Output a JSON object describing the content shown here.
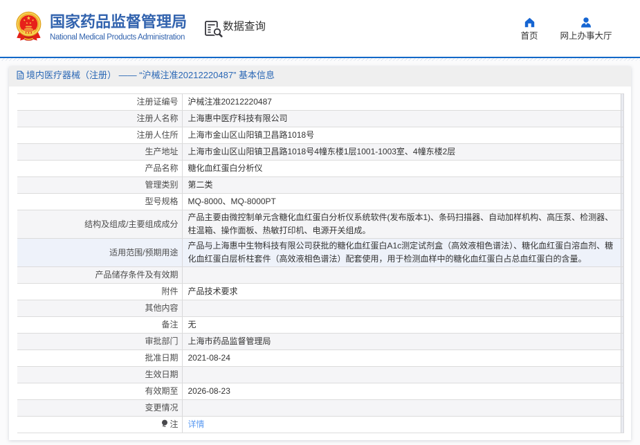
{
  "brand": {
    "title_cn": "国家药品监督管理局",
    "title_en": "National Medical Products Administration",
    "emblem_icon": "china-national-emblem"
  },
  "nav": {
    "data_query": {
      "label": "数据查询",
      "icon": "document-search-icon"
    },
    "home": {
      "label": "首页",
      "icon": "home-icon"
    },
    "hall": {
      "label": "网上办事大厅",
      "icon": "user-icon"
    }
  },
  "card": {
    "title": "境内医疗器械（注册） —— “沪械注准20212220487” 基本信息",
    "title_icon": "document-icon"
  },
  "colors": {
    "brand_blue": "#3263ae",
    "header_line_blue": "#1268c8",
    "icon_blue": "#1565d2",
    "titlebar_bg": "#efefef",
    "title_blue": "#2a67b5",
    "row_stripe": "#f5f5f7",
    "row_highlight": "#eef2fa",
    "link_blue": "#5c9bf2"
  },
  "table": {
    "rows": [
      {
        "label": "注册证编号",
        "value": "沪械注准20212220487"
      },
      {
        "label": "注册人名称",
        "value": "上海惠中医疗科技有限公司"
      },
      {
        "label": "注册人住所",
        "value": "上海市金山区山阳镇卫昌路1018号"
      },
      {
        "label": "生产地址",
        "value": "上海市金山区山阳镇卫昌路1018号4幢东楼1层1001-1003室、4幢东楼2层"
      },
      {
        "label": "产品名称",
        "value": "糖化血红蛋白分析仪"
      },
      {
        "label": "管理类别",
        "value": "第二类"
      },
      {
        "label": "型号规格",
        "value": "MQ-8000、MQ-8000PT"
      },
      {
        "label": "结构及组成/主要组成成分",
        "value": "产品主要由微控制单元含糖化血红蛋白分析仪系统软件(发布版本1)、条码扫描器、自动加样机构、高压泵、检测器、柱温箱、操作面板、热敏打印机、电源开关组成。"
      },
      {
        "label": "适用范围/预期用途",
        "value": "产品与上海惠中生物科技有限公司获批的糖化血红蛋白A1c测定试剂盒（高效液相色谱法）、糖化血红蛋白溶血剂、糖化血红蛋白层析柱套件（高效液相色谱法）配套使用，用于检测血样中的糖化血红蛋白占总血红蛋白的含量。",
        "highlight": true
      },
      {
        "label": "产品储存条件及有效期",
        "value": ""
      },
      {
        "label": "附件",
        "value": "产品技术要求"
      },
      {
        "label": "其他内容",
        "value": ""
      },
      {
        "label": "备注",
        "value": "无"
      },
      {
        "label": "审批部门",
        "value": "上海市药品监督管理局"
      },
      {
        "label": "批准日期",
        "value": "2021-08-24"
      },
      {
        "label": "生效日期",
        "value": ""
      },
      {
        "label": "有效期至",
        "value": "2026-08-23"
      },
      {
        "label": "变更情况",
        "value": ""
      },
      {
        "label": "注",
        "label_icon": "bulb-icon",
        "value": "详情",
        "value_is_link": true
      }
    ]
  }
}
